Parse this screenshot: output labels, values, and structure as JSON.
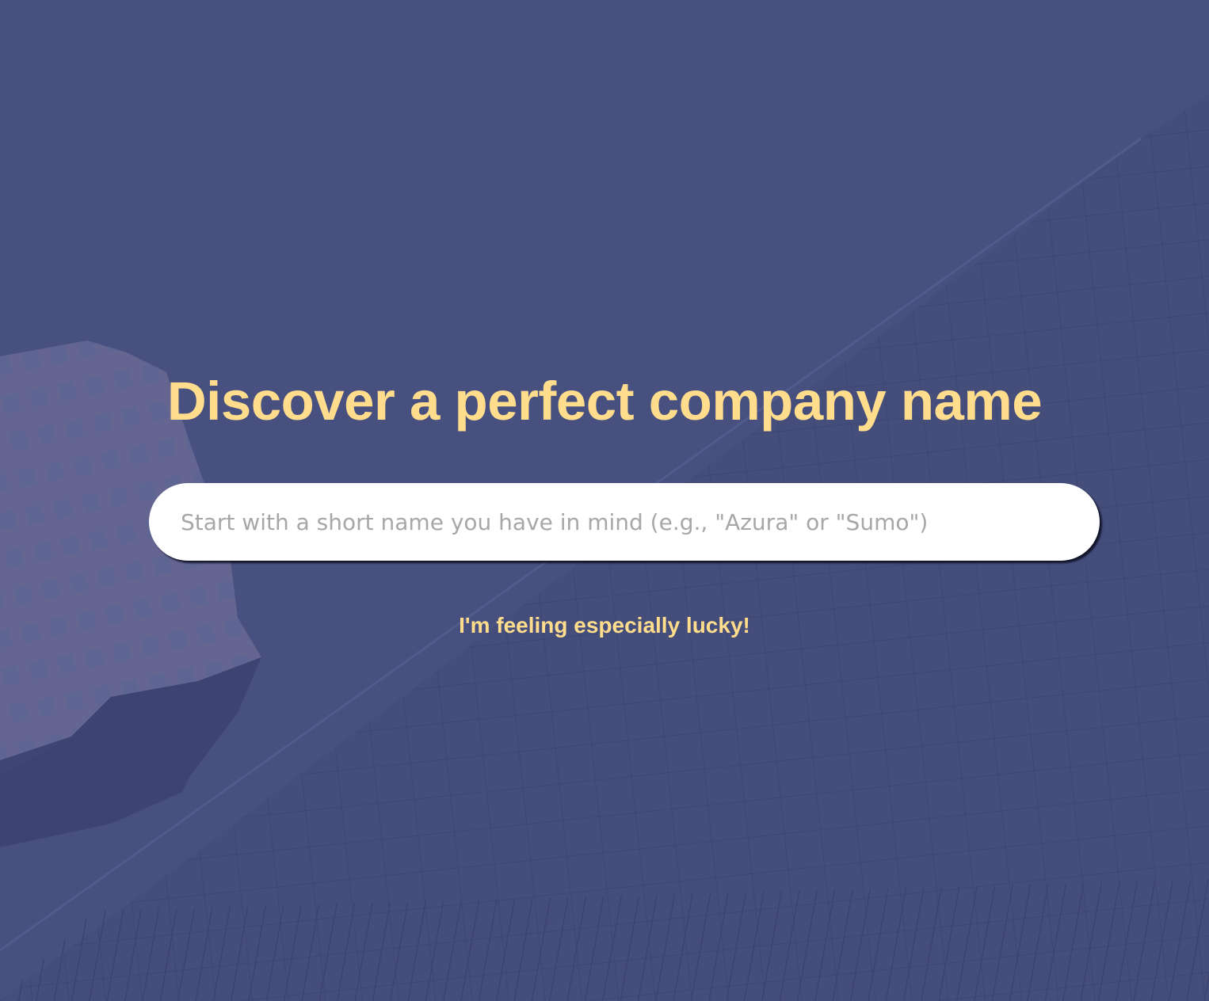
{
  "hero": {
    "headline": "Discover a perfect company name",
    "background_tint": "#47507f"
  },
  "search": {
    "placeholder": "Start with a short name you have in mind (e.g., \"Azura\" or \"Sumo\")",
    "value": ""
  },
  "lucky": {
    "label": "I'm feeling especially lucky!"
  },
  "colors": {
    "accent": "#ffdd8d",
    "background": "#47507f",
    "input_background": "#ffffff",
    "placeholder": "#a7a7a7"
  }
}
